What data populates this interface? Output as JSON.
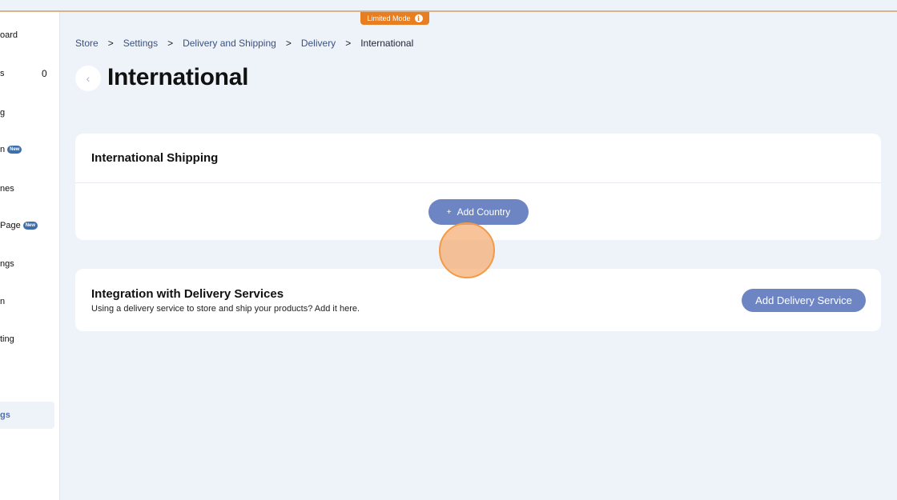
{
  "banner": {
    "limited_mode": "Limited Mode",
    "info_icon": "i"
  },
  "sidebar": {
    "items": [
      {
        "label": "oard"
      },
      {
        "label": "s",
        "count": "0"
      },
      {
        "label": "g"
      },
      {
        "label": "n",
        "badge": "New"
      },
      {
        "label": "nes"
      },
      {
        "label": "Page",
        "badge": "New"
      },
      {
        "label": "ngs"
      },
      {
        "label": "n"
      },
      {
        "label": "ting"
      }
    ],
    "active_label": "gs"
  },
  "breadcrumb": {
    "items": [
      "Store",
      "Settings",
      "Delivery and Shipping",
      "Delivery",
      "International"
    ],
    "separator": ">"
  },
  "header": {
    "back_icon": "‹",
    "title": "International"
  },
  "international_card": {
    "title": "International Shipping",
    "add_country_plus": "+",
    "add_country_label": "Add Country"
  },
  "delivery_card": {
    "title": "Integration with Delivery Services",
    "description": "Using a delivery service to store and ship your products? Add it here.",
    "add_service_label": "Add Delivery Service"
  },
  "colors": {
    "accent_button": "#6e85c4",
    "limited_badge": "#e77e22",
    "background": "#eef2f9"
  }
}
